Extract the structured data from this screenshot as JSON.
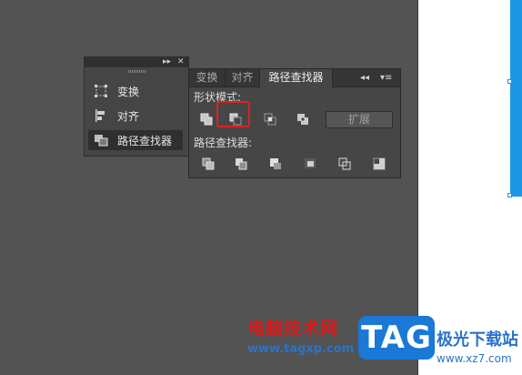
{
  "dock": {
    "controls": {
      "collapse": "▸▸",
      "close": "✕"
    },
    "items": [
      {
        "label": "变换",
        "icon": "transform-icon"
      },
      {
        "label": "对齐",
        "icon": "align-icon"
      },
      {
        "label": "路径查找器",
        "icon": "pathfinder-icon",
        "active": true
      }
    ]
  },
  "pathfinder_panel": {
    "tabs": [
      {
        "label": "变换"
      },
      {
        "label": "对齐"
      },
      {
        "label": "路径查找器",
        "active": true
      }
    ],
    "controls": {
      "collapse": "◂◂",
      "menu": "▾≡"
    },
    "shape_modes_label": "形状模式:",
    "shape_mode_buttons": [
      "unite-icon",
      "minus-front-icon",
      "intersect-icon",
      "exclude-icon"
    ],
    "expand_label": "扩展",
    "pathfinders_label": "路径查找器:",
    "pathfinder_buttons": [
      "divide-icon",
      "trim-icon",
      "merge-icon",
      "crop-icon",
      "outline-icon",
      "minus-back-icon"
    ],
    "highlighted_button": "minus-front-icon"
  },
  "colors": {
    "canvas": "#535353",
    "panel": "#464646",
    "selection": "#1e96e6",
    "highlight": "#e02020"
  },
  "watermark": {
    "title": "电脑技术网",
    "url": "www.tagxp.com",
    "badge": "TAG",
    "site": "极光下载站",
    "site_url": "www.xz7.com"
  }
}
